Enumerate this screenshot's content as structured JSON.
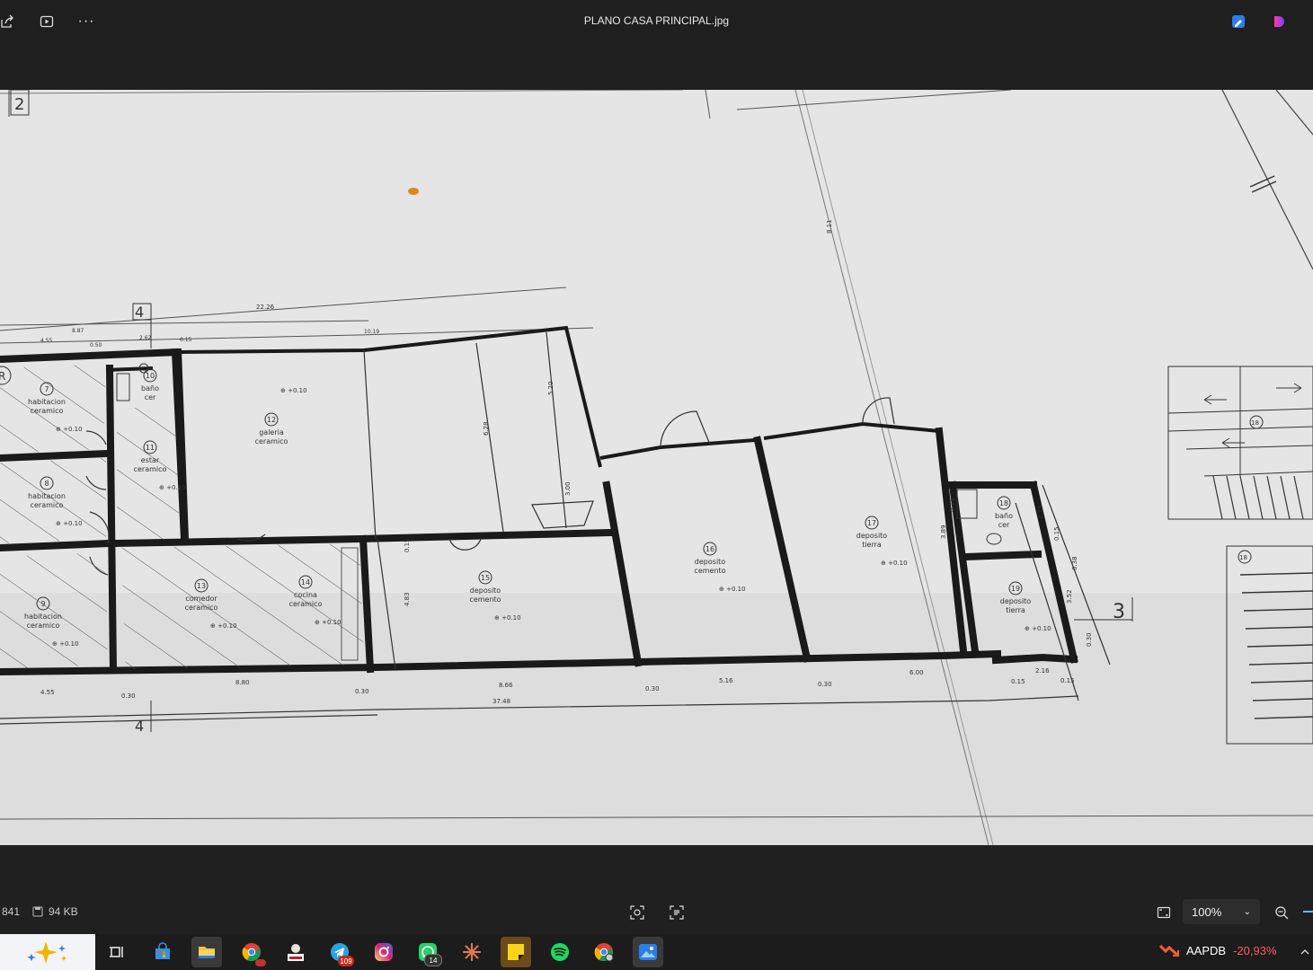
{
  "window": {
    "title": "PLANO CASA PRINCIPAL.jpg",
    "left_icons": [
      "share-icon",
      "slideshow-icon",
      "more-options-icon"
    ],
    "more_label": "···",
    "right_icons": [
      "edit-app-icon",
      "clipchamp-icon"
    ]
  },
  "floorplan": {
    "rooms": [
      {
        "num": "7",
        "name": "habitacion",
        "finish": "ceramico"
      },
      {
        "num": "8",
        "name": "habitacion",
        "finish": "ceramico"
      },
      {
        "num": "9",
        "name": "habitacion",
        "finish": "ceramico"
      },
      {
        "num": "10",
        "name": "baño",
        "finish": "cer"
      },
      {
        "num": "11",
        "name": "estar",
        "finish": "ceramico"
      },
      {
        "num": "12",
        "name": "galeria",
        "finish": "ceramico"
      },
      {
        "num": "13",
        "name": "comedor",
        "finish": "ceramico"
      },
      {
        "num": "14",
        "name": "cocina",
        "finish": "ceramico"
      },
      {
        "num": "15",
        "name": "deposito",
        "finish": "cemento"
      },
      {
        "num": "16",
        "name": "deposito",
        "finish": "cemento"
      },
      {
        "num": "17",
        "name": "deposito",
        "finish": "tierra"
      },
      {
        "num": "18",
        "name": "baño",
        "finish": "cer"
      },
      {
        "num": "19",
        "name": "deposito",
        "finish": "tierra"
      }
    ],
    "level": "+0.10",
    "dims_top": [
      "22.26",
      "8.87",
      "4.55",
      "0.50",
      "2.62",
      "0.15",
      "10.19"
    ],
    "dims_bottom": [
      "4.55",
      "0.30",
      "8.80",
      "0.30",
      "8.66",
      "0.30",
      "5.16",
      "0.30",
      "6.00",
      "0.15",
      "2.16",
      "0.15",
      "37.48"
    ],
    "dims_vertical": [
      "6.28",
      "5.20",
      "3.00",
      "0.15",
      "4.83",
      "3.89",
      "0.15",
      "2.75",
      "0.15",
      "6.38",
      "3.52",
      "0.30",
      "8.11"
    ],
    "section_marks": [
      "2",
      "4",
      "4",
      "3"
    ],
    "stair_label": "18",
    "stair_label2": "18",
    "corner_letter": "R"
  },
  "status": {
    "dimensions": "841",
    "size": "94 KB",
    "zoom": "100%"
  },
  "taskbar": {
    "apps": [
      {
        "name": "task-view-icon",
        "badge": ""
      },
      {
        "name": "store-icon",
        "badge": ""
      },
      {
        "name": "file-explorer-icon",
        "badge": ""
      },
      {
        "name": "chrome-icon",
        "badge": ""
      },
      {
        "name": "profile-app-icon",
        "badge": ""
      },
      {
        "name": "telegram-icon",
        "badge": "109"
      },
      {
        "name": "instagram-icon",
        "badge": ""
      },
      {
        "name": "whatsapp-icon",
        "badge": "14"
      },
      {
        "name": "claude-icon",
        "badge": ""
      },
      {
        "name": "sticky-notes-icon",
        "badge": ""
      },
      {
        "name": "spotify-icon",
        "badge": ""
      },
      {
        "name": "chrome-profile-icon",
        "badge": ""
      },
      {
        "name": "photos-icon",
        "badge": ""
      }
    ],
    "stock_name": "AAPDB",
    "stock_change": "-20,93%",
    "stock_color": "#ff5c5c"
  }
}
